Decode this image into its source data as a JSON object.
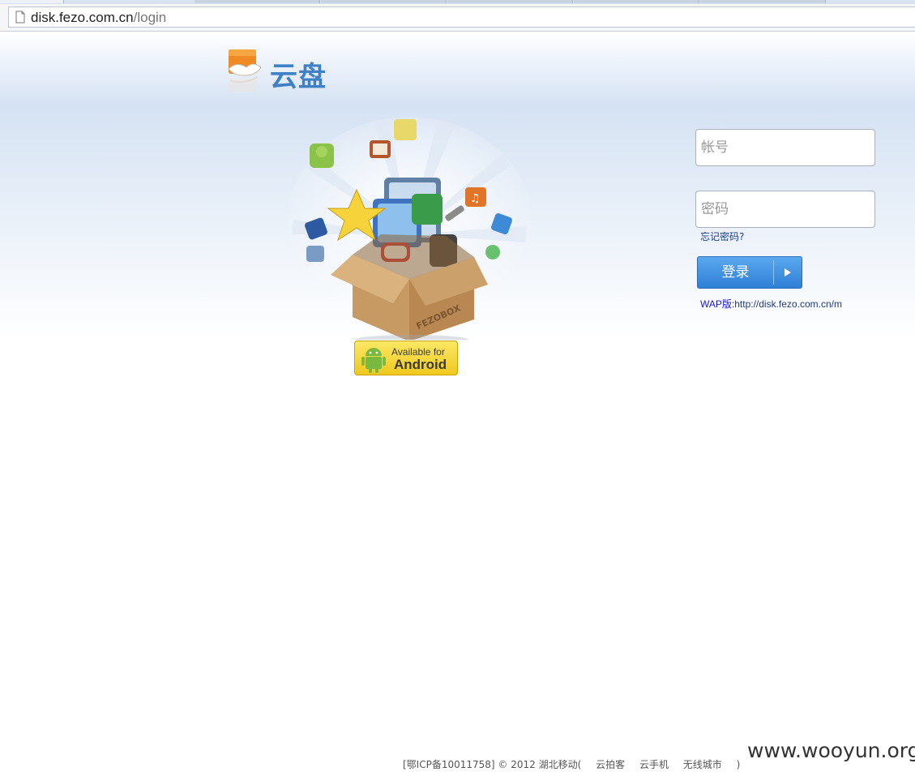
{
  "browser": {
    "url_host": "disk.fezo.com.cn",
    "url_path": "/login"
  },
  "logo": {
    "text": "云盘"
  },
  "hero": {
    "box_label": "FEZOBOX"
  },
  "android_badge": {
    "line1": "Available for",
    "line2": "Android"
  },
  "login": {
    "account_placeholder": "帐号",
    "password_placeholder": "密码",
    "forgot_link": "忘记密码?",
    "submit_label": "登录",
    "wap_label": "WAP版:",
    "wap_url": "http://disk.fezo.com.cn/m"
  },
  "footer": {
    "copyright": "[鄂ICP备10011758] © 2012 湖北移动(",
    "links": [
      "云拍客",
      "云手机",
      "无线城市"
    ],
    "close": ")"
  },
  "watermark": "www.wooyun.org",
  "colors": {
    "accent": "#3f80c7",
    "button": "#2f7fd6"
  }
}
